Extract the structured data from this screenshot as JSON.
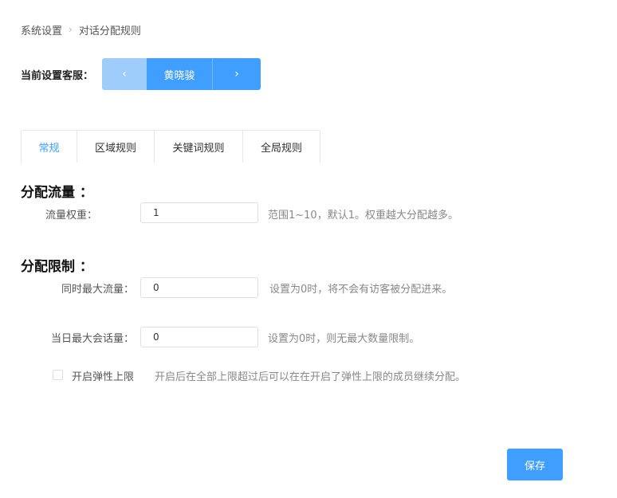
{
  "breadcrumb": {
    "parent": "系统设置",
    "current": "对话分配规则",
    "separator_icon": "chevron-right-icon"
  },
  "agent_selector": {
    "label": "当前设置客服：",
    "name": "黄晓骏",
    "prev_icon": "chevron-left-icon",
    "next_icon": "chevron-right-icon"
  },
  "tabs": [
    {
      "label": "常规",
      "active": true
    },
    {
      "label": "区域规则",
      "active": false
    },
    {
      "label": "关键词规则",
      "active": false
    },
    {
      "label": "全局规则",
      "active": false
    }
  ],
  "traffic": {
    "title": "分配流量 ：",
    "weight_label": "流量权重：",
    "weight_value": "1",
    "weight_hint": "范围1~10，默认1。权重越大分配越多。"
  },
  "limits": {
    "title": "分配限制 ：",
    "concurrent_label": "同时最大流量：",
    "concurrent_value": "0",
    "concurrent_hint": "设置为0时，将不会有访客被分配进来。",
    "daily_label": "当日最大会话量：",
    "daily_value": "0",
    "daily_hint": "设置为0时，则无最大数量限制。",
    "elastic_checked": false,
    "elastic_label": "开启弹性上限",
    "elastic_hint": "开启后在全部上限超过后可以在在开启了弹性上限的成员继续分配。"
  },
  "save_label": "保存",
  "colors": {
    "primary": "#409eff",
    "primary_light": "#9fcdfb",
    "border": "#dcdfe6",
    "hint_text": "#888888"
  }
}
